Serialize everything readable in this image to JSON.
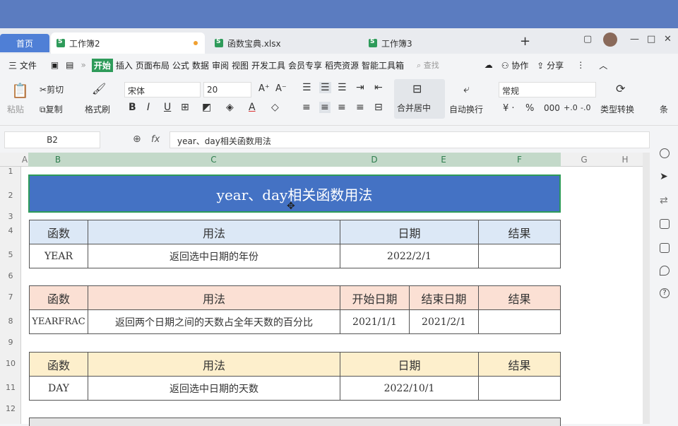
{
  "tabs": {
    "home": "首页",
    "items": [
      {
        "label": "工作簿2",
        "active": true,
        "modified": true
      },
      {
        "label": "函数宝典.xlsx",
        "active": false
      },
      {
        "label": "工作簿3",
        "active": false
      }
    ],
    "add": "+"
  },
  "window_controls": {
    "layout": "▢",
    "minimize": "—",
    "maximize": "□",
    "close": "✕"
  },
  "menu": {
    "file": "三 文件",
    "items": [
      "开始",
      "插入",
      "页面布局",
      "公式",
      "数据",
      "审阅",
      "视图",
      "开发工具",
      "会员专享",
      "稻壳资源",
      "智能工具箱"
    ],
    "search": "查找",
    "collab": "协作",
    "share": "分享"
  },
  "ribbon": {
    "paste": "粘贴",
    "cut": "剪切",
    "copy": "复制",
    "format_painter": "格式刷",
    "font": "宋体",
    "size": "20",
    "merge": "合并居中",
    "wrap": "自动换行",
    "number_format": "常规",
    "type_convert": "类型转换",
    "cond": "条"
  },
  "formula_bar": {
    "name_box": "B2",
    "fx": "fx",
    "content": "year、day相关函数用法"
  },
  "columns": [
    "A",
    "B",
    "C",
    "D",
    "E",
    "F",
    "G",
    "H"
  ],
  "rows": [
    "1",
    "2",
    "3",
    "4",
    "5",
    "6",
    "7",
    "8",
    "9",
    "10",
    "11",
    "12"
  ],
  "sheet": {
    "title": "year、day相关函数用法",
    "table1": {
      "headers": [
        "函数",
        "用法",
        "日期",
        "结果"
      ],
      "row": [
        "YEAR",
        "返回选中日期的年份",
        "2022/2/1",
        ""
      ]
    },
    "table2": {
      "headers": [
        "函数",
        "用法",
        "开始日期",
        "结束日期",
        "结果"
      ],
      "row": [
        "YEARFRAC",
        "返回两个日期之间的天数占全年天数的百分比",
        "2021/1/1",
        "2021/2/1",
        ""
      ]
    },
    "table3": {
      "headers": [
        "函数",
        "用法",
        "日期",
        "结果"
      ],
      "row": [
        "DAY",
        "返回选中日期的天数",
        "2022/10/1",
        ""
      ]
    }
  },
  "colors": {
    "title_bg": "#4472c4",
    "t1_header": "#dce8f6",
    "t2_header": "#fbe0d4",
    "t3_header": "#fdefcc",
    "accent": "#2e9b5a"
  }
}
